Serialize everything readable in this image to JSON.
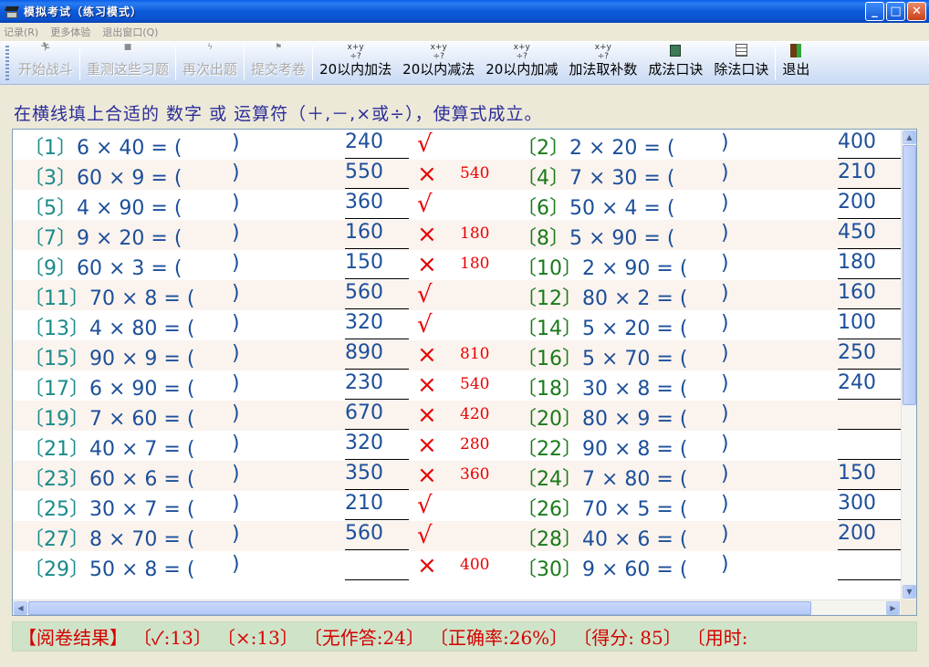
{
  "window": {
    "title": "模拟考试（练习模式）"
  },
  "menu": [
    "记录(R)",
    "更多体验",
    "退出窗口(Q)"
  ],
  "toolbar": [
    {
      "label": "开始战斗",
      "icon": "run-icon",
      "disabled": true
    },
    {
      "label": "重测这些习题",
      "icon": "retest-icon",
      "disabled": true
    },
    {
      "label": "再次出题",
      "icon": "regenerate-icon",
      "disabled": true
    },
    {
      "label": "提交考卷",
      "icon": "flag-icon",
      "disabled": true
    },
    {
      "label": "20以内加法",
      "icon": "math-ops-icon",
      "disabled": false
    },
    {
      "label": "20以内减法",
      "icon": "math-ops-icon",
      "disabled": false
    },
    {
      "label": "20以内加减",
      "icon": "math-ops-icon",
      "disabled": false
    },
    {
      "label": "加法取补数",
      "icon": "math-ops-icon",
      "disabled": false
    },
    {
      "label": "成法口诀",
      "icon": "calculator-icon",
      "disabled": false
    },
    {
      "label": "除法口诀",
      "icon": "document-icon",
      "disabled": false
    },
    {
      "label": "退出",
      "icon": "exit-door-icon",
      "disabled": false
    }
  ],
  "instruction": "在横线填上合适的 数字 或 运算符（＋,－,×或÷），使算式成立。",
  "left_questions": [
    {
      "num": "〔1〕",
      "expr": "6 × 40 = (",
      "close": ")",
      "answer": "240",
      "mark": "√",
      "correct": ""
    },
    {
      "num": "〔3〕",
      "expr": "60 × 9 = (",
      "close": ")",
      "answer": "550",
      "mark": "×",
      "correct": "540"
    },
    {
      "num": "〔5〕",
      "expr": "4 × 90 = (",
      "close": ")",
      "answer": "360",
      "mark": "√",
      "correct": ""
    },
    {
      "num": "〔7〕",
      "expr": "9 × 20 = (",
      "close": ")",
      "answer": "160",
      "mark": "×",
      "correct": "180"
    },
    {
      "num": "〔9〕",
      "expr": "60 × 3 = (",
      "close": ")",
      "answer": "150",
      "mark": "×",
      "correct": "180"
    },
    {
      "num": "〔11〕",
      "expr": "70 × 8 = (",
      "close": ")",
      "answer": "560",
      "mark": "√",
      "correct": ""
    },
    {
      "num": "〔13〕",
      "expr": "4 × 80 = (",
      "close": ")",
      "answer": "320",
      "mark": "√",
      "correct": ""
    },
    {
      "num": "〔15〕",
      "expr": "90 × 9 = (",
      "close": ")",
      "answer": "890",
      "mark": "×",
      "correct": "810"
    },
    {
      "num": "〔17〕",
      "expr": "6 × 90 = (",
      "close": ")",
      "answer": "230",
      "mark": "×",
      "correct": "540"
    },
    {
      "num": "〔19〕",
      "expr": "7 × 60 = (",
      "close": ")",
      "answer": "670",
      "mark": "×",
      "correct": "420"
    },
    {
      "num": "〔21〕",
      "expr": "40 × 7 = (",
      "close": ")",
      "answer": "320",
      "mark": "×",
      "correct": "280"
    },
    {
      "num": "〔23〕",
      "expr": "60 × 6 = (",
      "close": ")",
      "answer": "350",
      "mark": "×",
      "correct": "360"
    },
    {
      "num": "〔25〕",
      "expr": "30 × 7 = (",
      "close": ")",
      "answer": "210",
      "mark": "√",
      "correct": ""
    },
    {
      "num": "〔27〕",
      "expr": "8 × 70 = (",
      "close": ")",
      "answer": "560",
      "mark": "√",
      "correct": ""
    },
    {
      "num": "〔29〕",
      "expr": "50 × 8 = (",
      "close": ")",
      "answer": "",
      "mark": "×",
      "correct": "400"
    }
  ],
  "right_questions": [
    {
      "num": "〔2〕",
      "expr": "2 × 20 = (",
      "close": ")",
      "answer": "400"
    },
    {
      "num": "〔4〕",
      "expr": "7 × 30 = (",
      "close": ")",
      "answer": "210"
    },
    {
      "num": "〔6〕",
      "expr": "50 × 4 = (",
      "close": ")",
      "answer": "200"
    },
    {
      "num": "〔8〕",
      "expr": "5 × 90 = (",
      "close": ")",
      "answer": "450"
    },
    {
      "num": "〔10〕",
      "expr": "2 × 90 = (",
      "close": ")",
      "answer": "180"
    },
    {
      "num": "〔12〕",
      "expr": "80 × 2 = (",
      "close": ")",
      "answer": "160"
    },
    {
      "num": "〔14〕",
      "expr": "5 × 20 = (",
      "close": ")",
      "answer": "100"
    },
    {
      "num": "〔16〕",
      "expr": "5 × 70 = (",
      "close": ")",
      "answer": "250"
    },
    {
      "num": "〔18〕",
      "expr": "30 × 8 = (",
      "close": ")",
      "answer": "240"
    },
    {
      "num": "〔20〕",
      "expr": "80 × 9 = (",
      "close": ")",
      "answer": ""
    },
    {
      "num": "〔22〕",
      "expr": "90 × 8 = (",
      "close": ")",
      "answer": ""
    },
    {
      "num": "〔24〕",
      "expr": "7 × 80 = (",
      "close": ")",
      "answer": "150"
    },
    {
      "num": "〔26〕",
      "expr": "70 × 5 = (",
      "close": ")",
      "answer": "300"
    },
    {
      "num": "〔28〕",
      "expr": "40 × 6 = (",
      "close": ")",
      "answer": "200"
    },
    {
      "num": "〔30〕",
      "expr": "9 × 60 = (",
      "close": ")",
      "answer": ""
    }
  ],
  "status": {
    "label": "【阅卷结果】",
    "correct": "〔✓:13〕",
    "wrong": "〔×:13〕",
    "unanswered": "〔无作答:24〕",
    "rate": "〔正确率:26%〕",
    "score": "〔得分: 85〕",
    "time": "〔用时:"
  },
  "colors": {
    "title_bar": "#0b5ad8",
    "question_blue": "#1c4f9a",
    "number_teal": "#1a8a8a",
    "number_green": "#1a7a1a",
    "mark_red": "#e80000",
    "status_bg": "#cfe3c8",
    "row_alt": "#fbf3ee"
  }
}
